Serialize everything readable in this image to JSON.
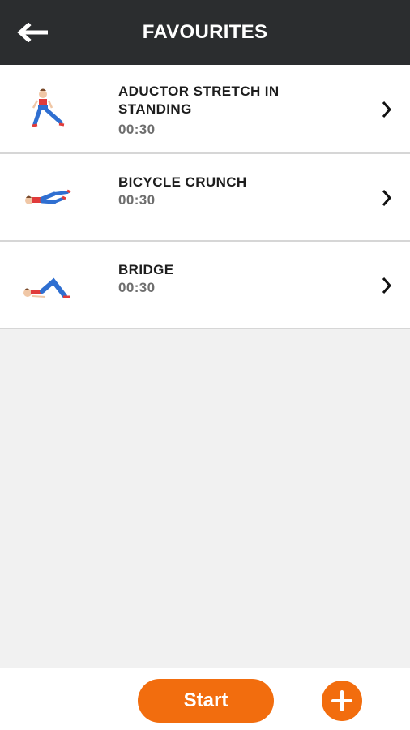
{
  "header": {
    "title": "FAVOURITES",
    "back_icon": "arrow-left-icon"
  },
  "exercises": [
    {
      "name": "ADUCTOR STRETCH IN STANDING",
      "duration": "00:30",
      "illustration": "standing-adductor-stretch"
    },
    {
      "name": "BICYCLE CRUNCH",
      "duration": "00:30",
      "illustration": "bicycle-crunch"
    },
    {
      "name": "BRIDGE",
      "duration": "00:30",
      "illustration": "bridge"
    }
  ],
  "footer": {
    "start_label": "Start",
    "add_icon": "plus-icon"
  },
  "colors": {
    "header_bg": "#2b2d2f",
    "accent": "#f26d0e",
    "background": "#f1f1f1"
  }
}
